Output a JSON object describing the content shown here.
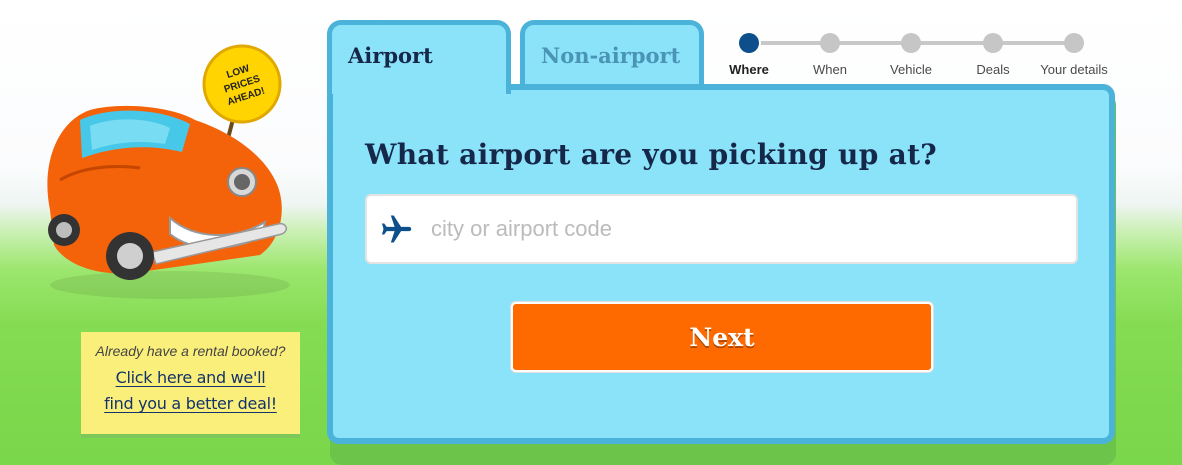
{
  "mascot": {
    "sign_lines": [
      "LOW",
      "PRICES",
      "AHEAD!"
    ]
  },
  "booked_note": {
    "question": "Already have a rental booked?",
    "link_line1": "Click here and we'll",
    "link_line2": "find you a better deal!"
  },
  "tabs": [
    {
      "label": "Airport",
      "active": true
    },
    {
      "label": "Non-airport",
      "active": false
    }
  ],
  "steps": [
    {
      "label": "Where",
      "active": true
    },
    {
      "label": "When",
      "active": false
    },
    {
      "label": "Vehicle",
      "active": false
    },
    {
      "label": "Deals",
      "active": false
    },
    {
      "label": "Your details",
      "active": false
    }
  ],
  "form": {
    "question": "What airport are you picking up at?",
    "input_icon": "airplane-icon",
    "input_placeholder": "city or airport code",
    "input_value": "",
    "next_label": "Next"
  },
  "colors": {
    "panel": "#8be3fa",
    "panel_border": "#4bb3d9",
    "accent_button": "#ff6a00",
    "active_step": "#0d4f8b",
    "heading_text": "#16284a",
    "note_bg": "#fbef7b"
  }
}
